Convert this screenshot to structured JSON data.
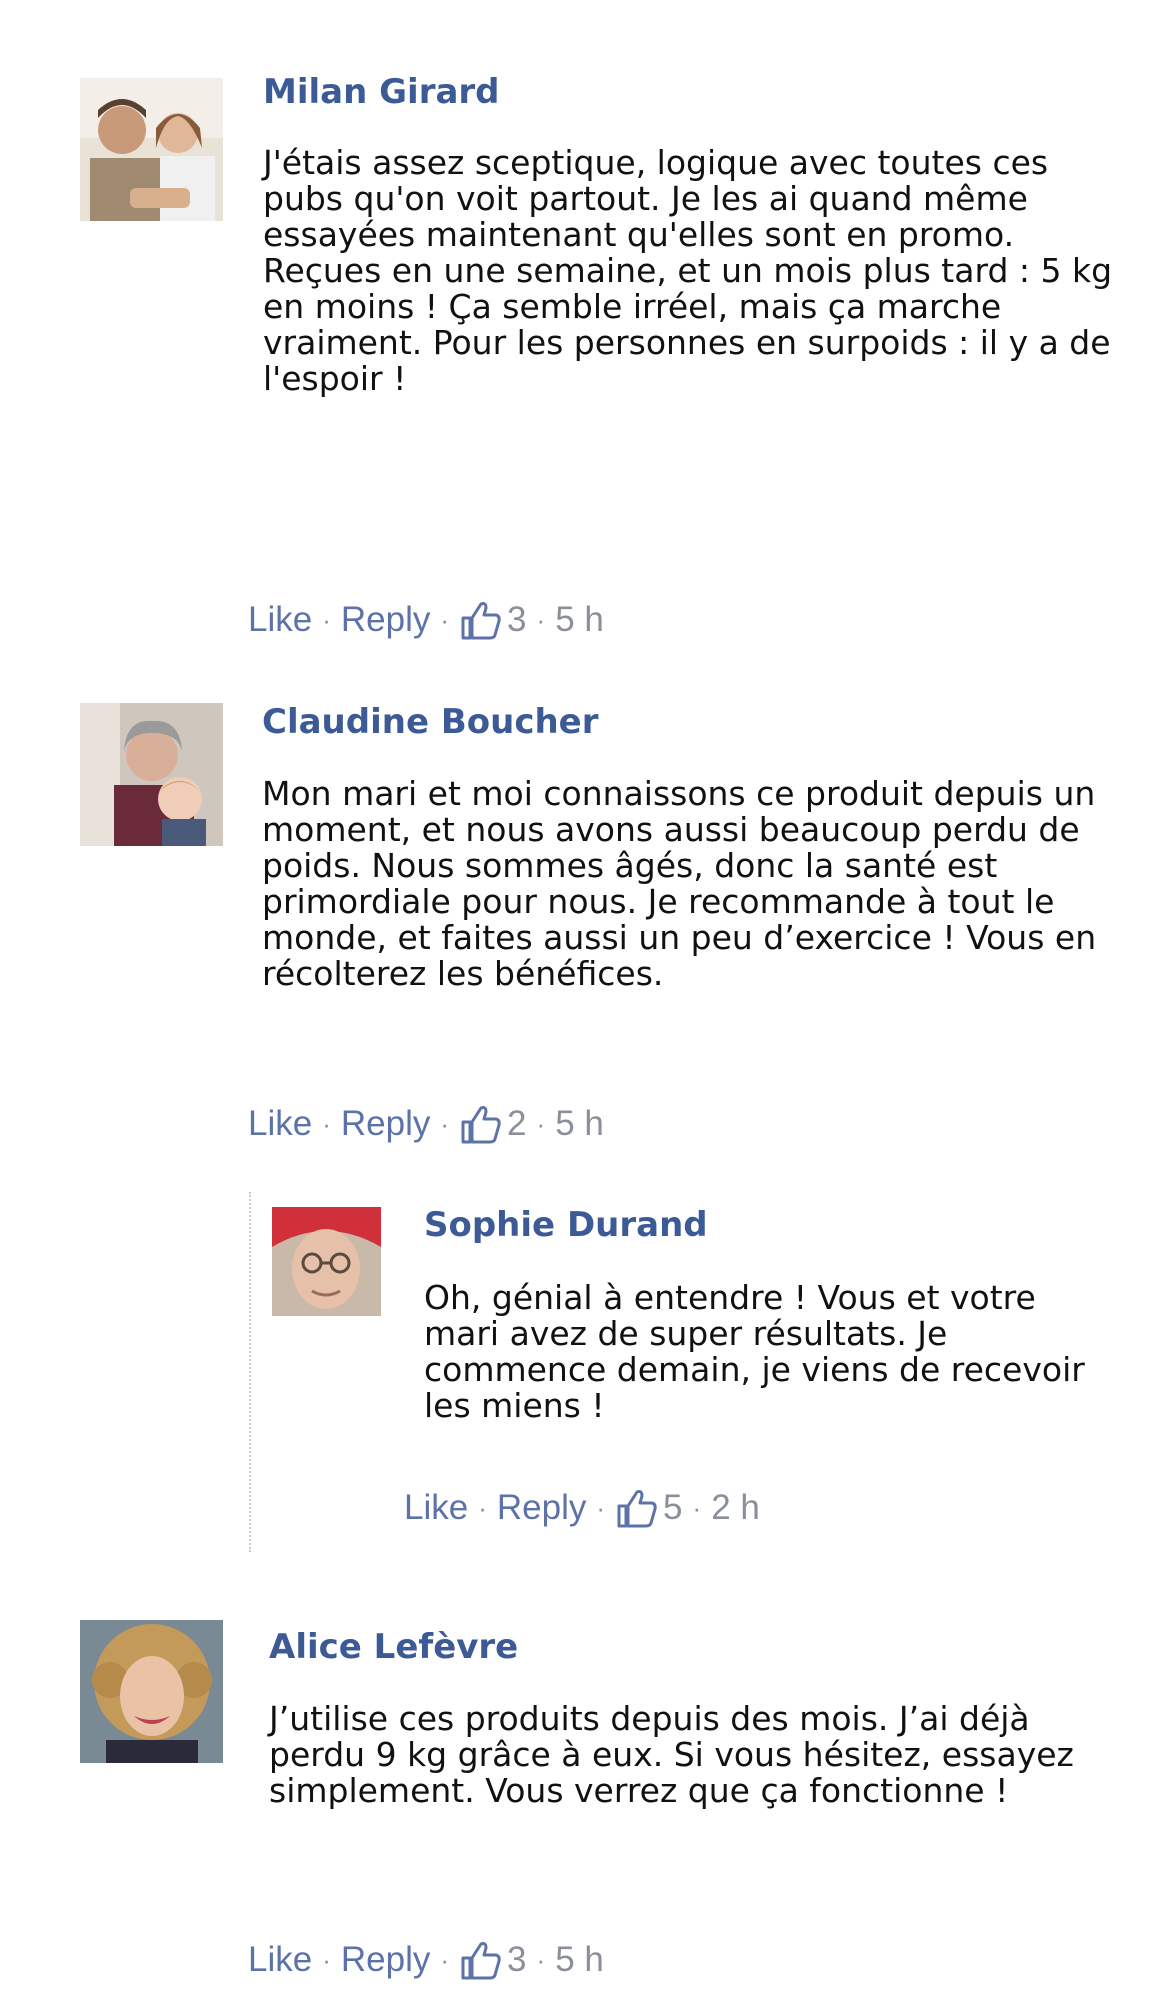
{
  "ui": {
    "like_label": "Like",
    "reply_label": "Reply",
    "separator": "·",
    "link_color": "#5d73a8",
    "name_color": "#3c5b96"
  },
  "comments": [
    {
      "name": "Milan Girard",
      "avatar": "man-and-child-photo",
      "text": "J'étais assez sceptique, logique avec toutes ces pubs qu'on voit partout. Je les ai quand même essayées maintenant qu'elles sont en promo. Reçues en une semaine, et un mois plus tard : 5 kg en moins ! Ça semble irréel, mais ça marche vraiment. Pour les personnes en surpoids : il y a de l'espoir !",
      "likes": "3",
      "time": "5 h"
    },
    {
      "name": "Claudine Boucher",
      "avatar": "grandmother-with-toddler-photo",
      "text": "Mon mari et moi connaissons ce produit depuis un moment, et nous avons aussi beaucoup perdu de poids. Nous sommes âgés, donc la santé est primordiale pour nous. Je recommande à tout le monde, et faites aussi un peu d’exercice ! Vous en récolterez les bénéfices.",
      "likes": "2",
      "time": "5 h",
      "replies": [
        {
          "name": "Sophie Durand",
          "avatar": "elderly-woman-red-headscarf-photo",
          "text": "Oh, génial à entendre ! Vous et votre mari avez de super résultats. Je commence demain, je viens de recevoir les miens !",
          "likes": "5",
          "time": "2 h"
        }
      ]
    },
    {
      "name": "Alice Lefèvre",
      "avatar": "curly-haired-woman-photo",
      "text": "J’utilise ces produits depuis des mois. J’ai déjà perdu 9 kg grâce à eux. Si vous hésitez, essayez simplement. Vous verrez que ça fonctionne !",
      "likes": "3",
      "time": "5 h"
    }
  ]
}
